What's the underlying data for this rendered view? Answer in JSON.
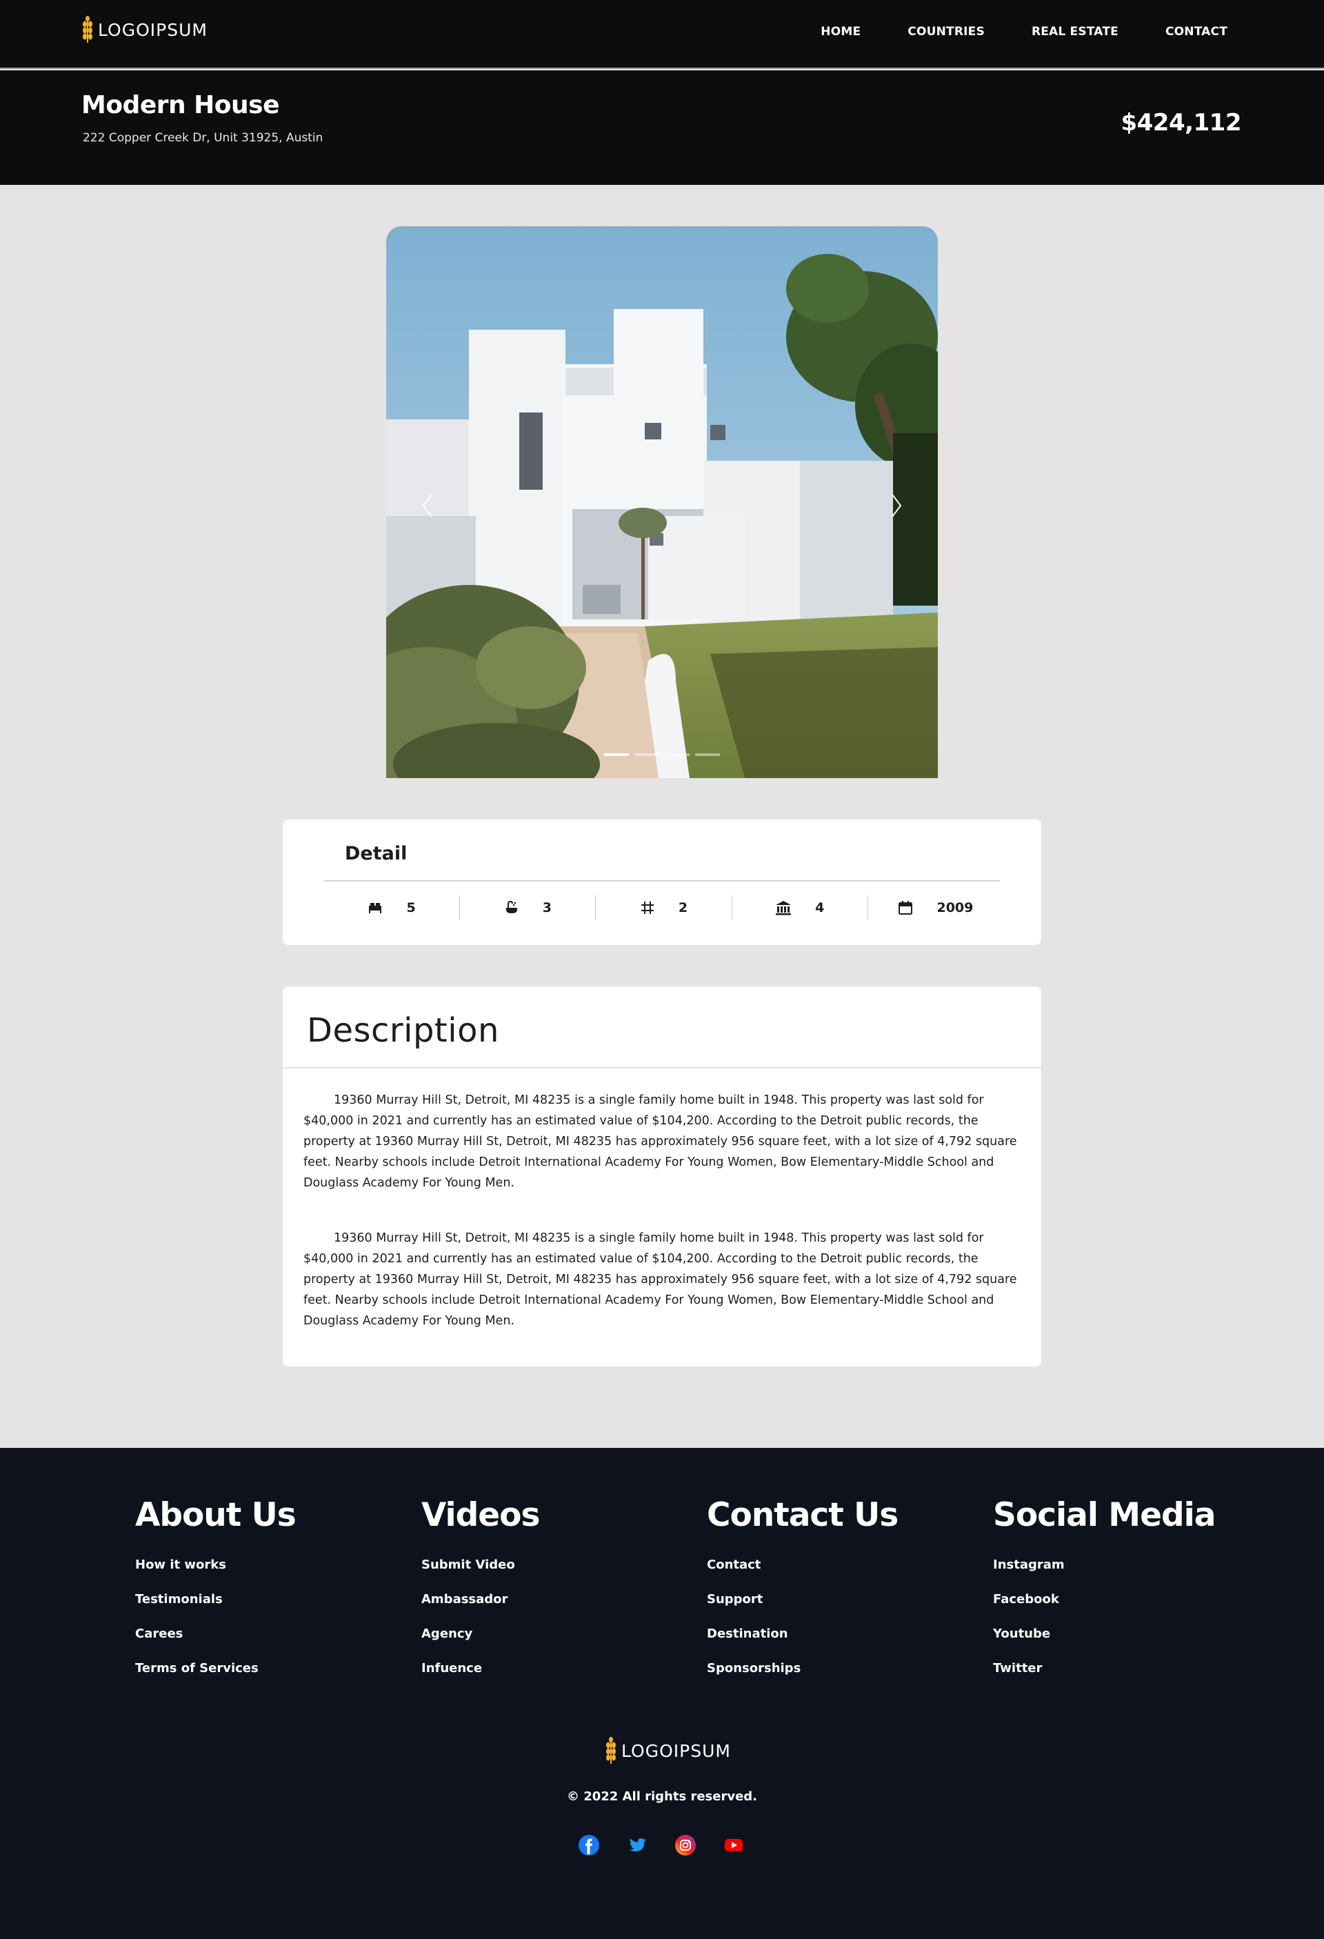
{
  "brand": {
    "logo_text": "LOGOIPSUM",
    "accent": "#f2b02a"
  },
  "nav": {
    "items": [
      {
        "label": "HOME"
      },
      {
        "label": "COUNTRIES"
      },
      {
        "label": "REAL ESTATE"
      },
      {
        "label": "CONTACT"
      }
    ]
  },
  "property": {
    "title": "Modern House",
    "address": "222 Copper Creek Dr, Unit 31925, Austin",
    "price": "$424,112"
  },
  "carousel": {
    "slide_count": 4,
    "active_index": 0
  },
  "detail": {
    "title": "Detail",
    "items": [
      {
        "icon": "bed-icon",
        "value": "5"
      },
      {
        "icon": "bath-icon",
        "value": "3"
      },
      {
        "icon": "area-grid-icon",
        "value": "2"
      },
      {
        "icon": "building-icon",
        "value": "4"
      },
      {
        "icon": "calendar-icon",
        "value": "2009"
      }
    ]
  },
  "description": {
    "title": "Description",
    "paragraphs": [
      "19360 Murray Hill St, Detroit, MI 48235 is a single family home built in 1948. This property was last sold for $40,000 in 2021 and currently has an estimated value of $104,200. According to the Detroit public records, the property at 19360 Murray Hill St, Detroit, MI 48235 has approximately 956 square feet, with a lot size of 4,792 square feet. Nearby schools include Detroit International Academy For Young Women, Bow Elementary-Middle School and Douglass Academy For Young Men.",
      "19360 Murray Hill St, Detroit, MI 48235 is a single family home built in 1948. This property was last sold for $40,000 in 2021 and currently has an estimated value of $104,200. According to the Detroit public records, the property at 19360 Murray Hill St, Detroit, MI 48235 has approximately 956 square feet, with a lot size of 4,792 square feet. Nearby schools include Detroit International Academy For Young Women, Bow Elementary-Middle School and Douglass Academy For Young Men."
    ]
  },
  "footer": {
    "columns": [
      {
        "title": "About Us",
        "links": [
          "How it works",
          "Testimonials",
          "Carees",
          "Terms of Services"
        ]
      },
      {
        "title": "Videos",
        "links": [
          "Submit Video",
          "Ambassador",
          "Agency",
          "Infuence"
        ]
      },
      {
        "title": "Contact Us",
        "links": [
          "Contact",
          "Support",
          "Destination",
          "Sponsorships"
        ]
      },
      {
        "title": "Social Media",
        "links": [
          "Instagram",
          "Facebook",
          "Youtube",
          "Twitter"
        ]
      }
    ],
    "copyright": "© 2022 All rights reserved.",
    "socials": [
      {
        "icon": "facebook-icon",
        "color": "#1877f2"
      },
      {
        "icon": "twitter-icon",
        "color": "#1d9bf0"
      },
      {
        "icon": "instagram-icon",
        "color": "#d6249f"
      },
      {
        "icon": "youtube-icon",
        "color": "#ff0000"
      }
    ]
  }
}
